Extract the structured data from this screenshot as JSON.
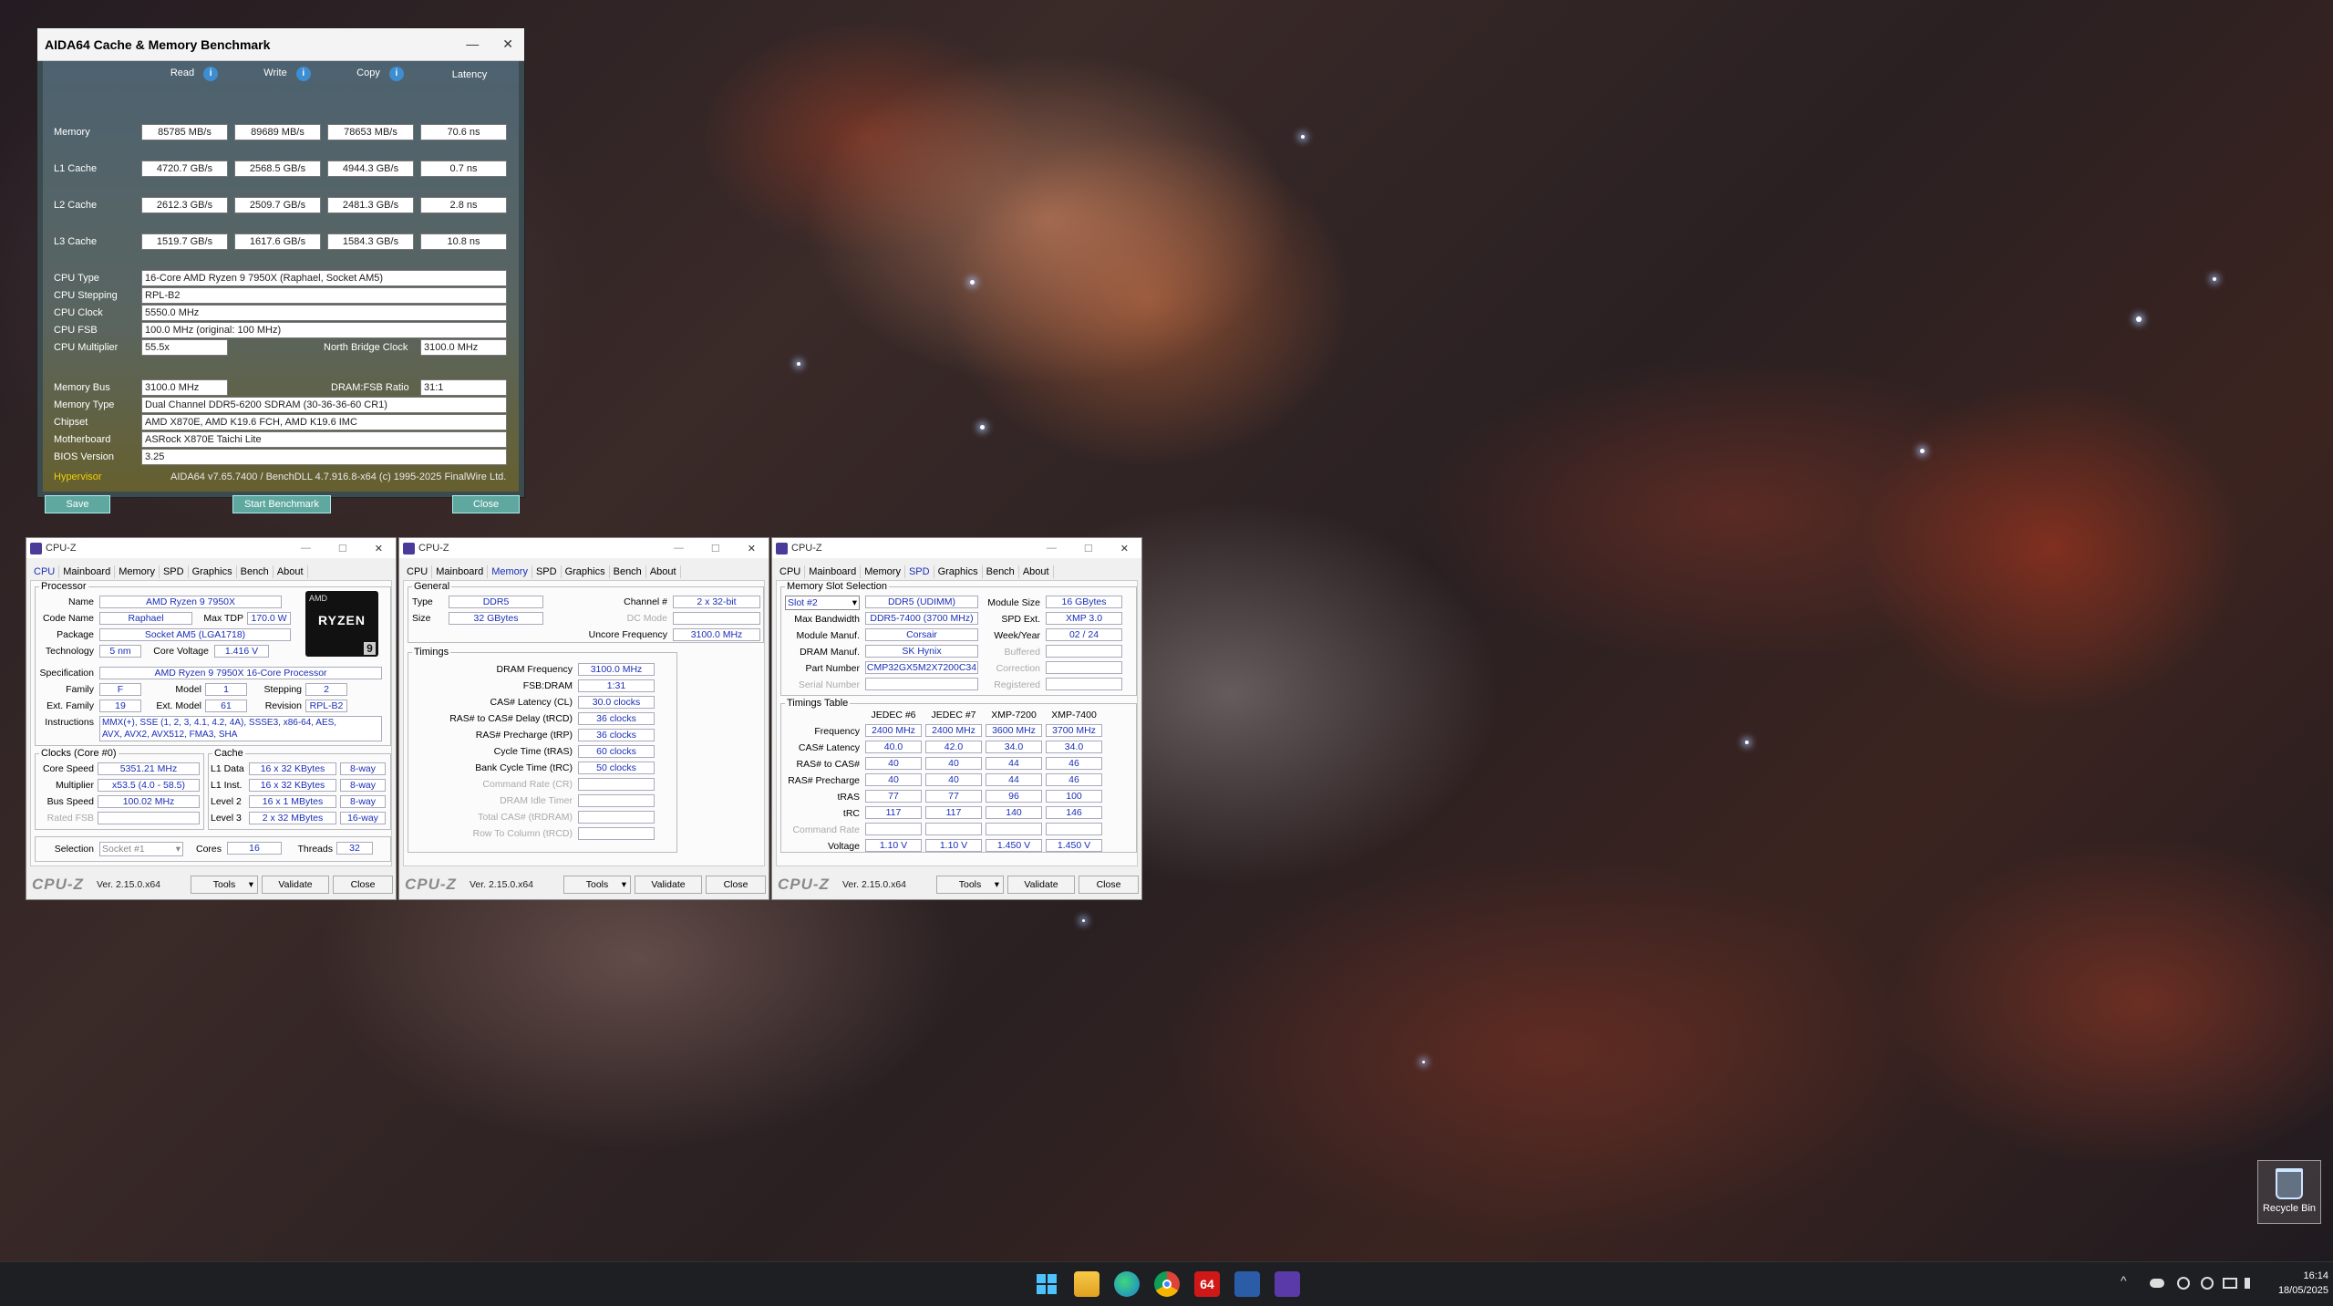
{
  "aida": {
    "title": "AIDA64 Cache & Memory Benchmark",
    "minimize": "—",
    "close_x": "✕",
    "headers": {
      "read": "Read",
      "write": "Write",
      "copy": "Copy",
      "latency": "Latency"
    },
    "info_icon": "i",
    "rows": [
      {
        "label": "Memory",
        "read": "85785 MB/s",
        "write": "89689 MB/s",
        "copy": "78653 MB/s",
        "latency": "70.6 ns"
      },
      {
        "label": "L1 Cache",
        "read": "4720.7 GB/s",
        "write": "2568.5 GB/s",
        "copy": "4944.3 GB/s",
        "latency": "0.7 ns"
      },
      {
        "label": "L2 Cache",
        "read": "2612.3 GB/s",
        "write": "2509.7 GB/s",
        "copy": "2481.3 GB/s",
        "latency": "2.8 ns"
      },
      {
        "label": "L3 Cache",
        "read": "1519.7 GB/s",
        "write": "1617.6 GB/s",
        "copy": "1584.3 GB/s",
        "latency": "10.8 ns"
      }
    ],
    "cpu_type_label": "CPU Type",
    "cpu_type": "16-Core AMD Ryzen 9 7950X  (Raphael, Socket AM5)",
    "cpu_stepping_label": "CPU Stepping",
    "cpu_stepping": "RPL-B2",
    "cpu_clock_label": "CPU Clock",
    "cpu_clock": "5550.0 MHz",
    "cpu_fsb_label": "CPU FSB",
    "cpu_fsb": "100.0 MHz  (original: 100 MHz)",
    "cpu_mult_label": "CPU Multiplier",
    "cpu_mult": "55.5x",
    "nb_clock_label": "North Bridge Clock",
    "nb_clock": "3100.0 MHz",
    "mem_bus_label": "Memory Bus",
    "mem_bus": "3100.0 MHz",
    "dram_fsb_label": "DRAM:FSB Ratio",
    "dram_fsb": "31:1",
    "mem_type_label": "Memory Type",
    "mem_type": "Dual Channel DDR5-6200 SDRAM  (30-36-36-60 CR1)",
    "chipset_label": "Chipset",
    "chipset": "AMD X870E, AMD K19.6 FCH, AMD K19.6 IMC",
    "mobo_label": "Motherboard",
    "mobo": "ASRock X870E Taichi Lite",
    "bios_label": "BIOS Version",
    "bios": "3.25",
    "hypervisor": "Hypervisor",
    "version": "AIDA64 v7.65.7400 / BenchDLL 4.7.916.8-x64  (c) 1995-2025 FinalWire Ltd.",
    "save": "Save",
    "start": "Start Benchmark",
    "close": "Close"
  },
  "cpuz_common": {
    "title": "CPU-Z",
    "tabs": [
      "CPU",
      "Mainboard",
      "Memory",
      "SPD",
      "Graphics",
      "Bench",
      "About"
    ],
    "logo": "CPU-Z",
    "version": "Ver. 2.15.0.x64",
    "tools": "Tools",
    "validate": "Validate",
    "close": "Close",
    "min": "—",
    "max": "☐",
    "x": "✕",
    "arrow": "▾"
  },
  "cpuz1": {
    "processor": "Processor",
    "name_l": "Name",
    "name": "AMD Ryzen 9 7950X",
    "codename_l": "Code Name",
    "codename": "Raphael",
    "maxtdp_l": "Max TDP",
    "maxtdp": "170.0 W",
    "package_l": "Package",
    "package": "Socket AM5 (LGA1718)",
    "tech_l": "Technology",
    "tech": "5 nm",
    "cvolt_l": "Core Voltage",
    "cvolt": "1.416 V",
    "spec_l": "Specification",
    "spec": "AMD Ryzen 9 7950X 16-Core Processor",
    "family_l": "Family",
    "family": "F",
    "model_l": "Model",
    "model": "1",
    "stepping_l": "Stepping",
    "stepping": "2",
    "extfam_l": "Ext. Family",
    "extfam": "19",
    "extmod_l": "Ext. Model",
    "extmod": "61",
    "rev_l": "Revision",
    "rev": "RPL-B2",
    "instr_l": "Instructions",
    "instr1": "MMX(+), SSE (1, 2, 3, 4.1, 4.2, 4A), SSSE3, x86-64, AES,",
    "instr2": "AVX, AVX2, AVX512, FMA3, SHA",
    "clocks": "Clocks (Core #0)",
    "cspeed_l": "Core Speed",
    "cspeed": "5351.21 MHz",
    "mult_l": "Multiplier",
    "mult": "x53.5 (4.0 - 58.5)",
    "bus_l": "Bus Speed",
    "bus": "100.02 MHz",
    "rfsb_l": "Rated FSB",
    "cache": "Cache",
    "l1d_l": "L1 Data",
    "l1d": "16 x 32 KBytes",
    "l1d_w": "8-way",
    "l1i_l": "L1 Inst.",
    "l1i": "16 x 32 KBytes",
    "l1i_w": "8-way",
    "l2_l": "Level 2",
    "l2": "16 x 1 MBytes",
    "l2_w": "8-way",
    "l3_l": "Level 3",
    "l3": "2 x 32 MBytes",
    "l3_w": "16-way",
    "sel_l": "Selection",
    "sel": "Socket #1",
    "cores_l": "Cores",
    "cores": "16",
    "threads_l": "Threads",
    "threads": "32",
    "badge_amd": "AMD",
    "badge_ryzen": "RYZEN",
    "badge_9": "9"
  },
  "cpuz2": {
    "general": "General",
    "type_l": "Type",
    "type": "DDR5",
    "size_l": "Size",
    "size": "32 GBytes",
    "chan_l": "Channel #",
    "chan": "2 x 32-bit",
    "dc_l": "DC Mode",
    "uncore_l": "Uncore Frequency",
    "uncore": "3100.0 MHz",
    "timings": "Timings",
    "rows": [
      {
        "l": "DRAM Frequency",
        "v": "3100.0 MHz"
      },
      {
        "l": "FSB:DRAM",
        "v": "1:31"
      },
      {
        "l": "CAS# Latency (CL)",
        "v": "30.0 clocks"
      },
      {
        "l": "RAS# to CAS# Delay (tRCD)",
        "v": "36 clocks"
      },
      {
        "l": "RAS# Precharge (tRP)",
        "v": "36 clocks"
      },
      {
        "l": "Cycle Time (tRAS)",
        "v": "60 clocks"
      },
      {
        "l": "Bank Cycle Time (tRC)",
        "v": "50 clocks"
      },
      {
        "l": "Command Rate (CR)",
        "v": ""
      },
      {
        "l": "DRAM Idle Timer",
        "v": ""
      },
      {
        "l": "Total CAS# (tRDRAM)",
        "v": ""
      },
      {
        "l": "Row To Column (tRCD)",
        "v": ""
      }
    ]
  },
  "cpuz3": {
    "slot_sel": "Memory Slot Selection",
    "slot": "Slot #2",
    "ddr": "DDR5 (UDIMM)",
    "modsize_l": "Module Size",
    "modsize": "16 GBytes",
    "maxbw_l": "Max Bandwidth",
    "maxbw": "DDR5-7400 (3700 MHz)",
    "spdext_l": "SPD Ext.",
    "spdext": "XMP 3.0",
    "manuf_l": "Module Manuf.",
    "manuf": "Corsair",
    "week_l": "Week/Year",
    "week": "02 / 24",
    "dram_l": "DRAM Manuf.",
    "dram": "SK Hynix",
    "buf_l": "Buffered",
    "part_l": "Part Number",
    "part": "CMP32GX5M2X7200C34",
    "corr_l": "Correction",
    "serial_l": "Serial Number",
    "reg_l": "Registered",
    "ttable": "Timings Table",
    "cols": [
      "JEDEC #6",
      "JEDEC #7",
      "XMP-7200",
      "XMP-7400"
    ],
    "rows": [
      {
        "l": "Frequency",
        "v": [
          "2400 MHz",
          "2400 MHz",
          "3600 MHz",
          "3700 MHz"
        ]
      },
      {
        "l": "CAS# Latency",
        "v": [
          "40.0",
          "42.0",
          "34.0",
          "34.0"
        ]
      },
      {
        "l": "RAS# to CAS#",
        "v": [
          "40",
          "40",
          "44",
          "46"
        ]
      },
      {
        "l": "RAS# Precharge",
        "v": [
          "40",
          "40",
          "44",
          "46"
        ]
      },
      {
        "l": "tRAS",
        "v": [
          "77",
          "77",
          "96",
          "100"
        ]
      },
      {
        "l": "tRC",
        "v": [
          "117",
          "117",
          "140",
          "146"
        ]
      },
      {
        "l": "Command Rate",
        "v": [
          "",
          "",
          "",
          ""
        ]
      },
      {
        "l": "Voltage",
        "v": [
          "1.10 V",
          "1.10 V",
          "1.450 V",
          "1.450 V"
        ]
      }
    ]
  },
  "desktop": {
    "recycle_bin": "Recycle Bin"
  },
  "taskbar": {
    "time": "16:14",
    "date": "18/05/2025",
    "aida_icon": "64",
    "chevron": "^"
  }
}
